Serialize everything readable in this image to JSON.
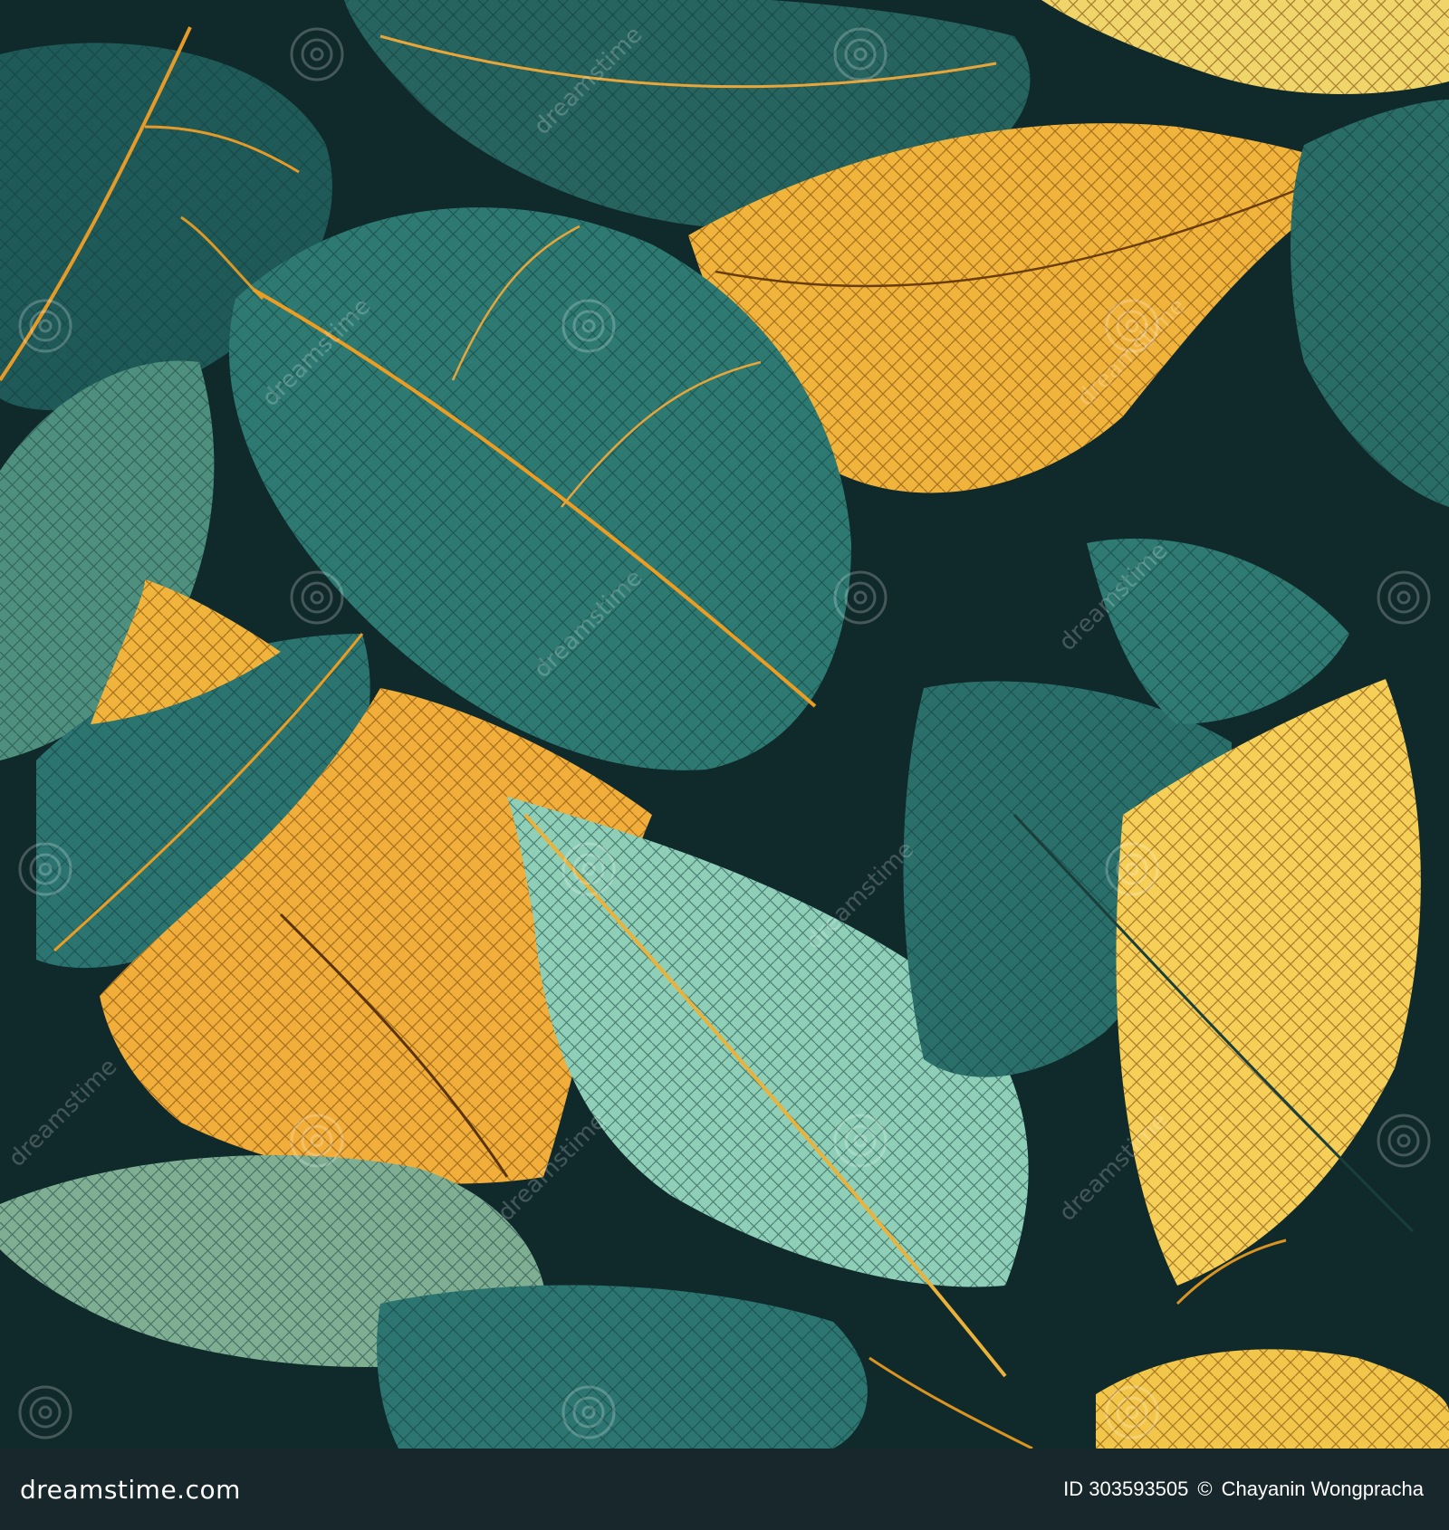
{
  "footer": {
    "logo_text": "dreamstime.com",
    "id_label": "ID 303593505",
    "separator": "©",
    "author": "Chayanin Wongpracha"
  },
  "watermark": {
    "text": "dreamstime"
  },
  "palette": {
    "background": "#10292b",
    "teal_dark": "#1f5a58",
    "teal_mid": "#2f7a72",
    "teal_light": "#6fb8a6",
    "mint": "#8fd1bb",
    "gold": "#e9a93a",
    "gold_light": "#f2c64a",
    "yellow_pale": "#f5dc6a",
    "vein_gold": "#f0a020",
    "footer": "#17272b"
  },
  "icons": {
    "watermark": "spiral-icon"
  }
}
